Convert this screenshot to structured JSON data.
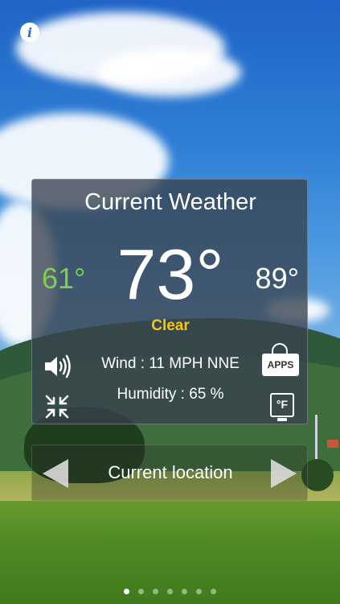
{
  "panel": {
    "title": "Current Weather",
    "temperature": "73°",
    "low": "61°",
    "high": "89°",
    "condition": "Clear",
    "wind": "Wind : 11 MPH NNE",
    "humidity": "Humidity : 65 %",
    "apps_label": "APPS",
    "unit_label": "°F"
  },
  "location": {
    "label": "Current location"
  },
  "pager": {
    "total_pages": 7,
    "current_page": 1
  },
  "colors": {
    "low_temp": "#7bd14d",
    "condition": "#f3c519",
    "panel_bg": "#37414e"
  },
  "icons": {
    "info": "info-icon",
    "sound": "speaker-icon",
    "compress": "compress-icon",
    "apps": "apps-sign-icon",
    "unit": "fahrenheit-unit-icon",
    "prev": "arrow-left-icon",
    "next": "arrow-right-icon"
  }
}
